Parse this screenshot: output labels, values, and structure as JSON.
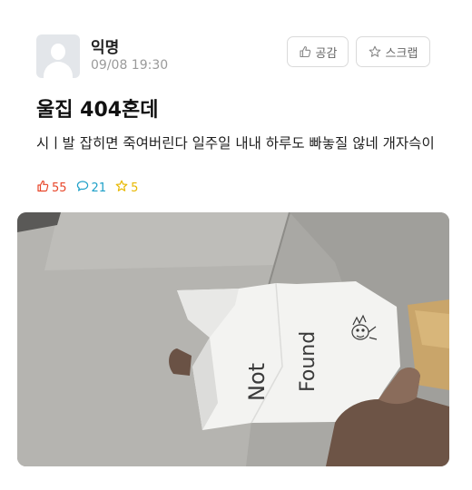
{
  "author": {
    "name": "익명",
    "timestamp": "09/08 19:30"
  },
  "actions": {
    "like_label": "공감",
    "scrap_label": "스크랩"
  },
  "post": {
    "title": "울집 404혼데",
    "body": "시ㅣ발 잡히면 죽여버린다 일주일 내내 하루도 빠놓질 않네 개자슥이"
  },
  "stats": {
    "likes": "55",
    "comments": "21",
    "scraps": "5"
  },
  "photo": {
    "note_line1": "Not",
    "note_line2": "Found"
  },
  "colors": {
    "like": "#e8472b",
    "comment": "#1ea0c8",
    "scrap": "#e8b800"
  },
  "icons": {
    "like": "thumbs-up-icon",
    "comment": "speech-bubble-icon",
    "scrap": "star-icon"
  }
}
